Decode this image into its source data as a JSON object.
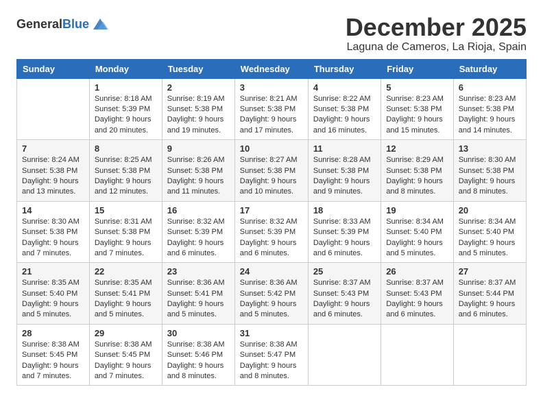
{
  "logo": {
    "general": "General",
    "blue": "Blue"
  },
  "title": "December 2025",
  "location": "Laguna de Cameros, La Rioja, Spain",
  "days_of_week": [
    "Sunday",
    "Monday",
    "Tuesday",
    "Wednesday",
    "Thursday",
    "Friday",
    "Saturday"
  ],
  "weeks": [
    [
      {
        "day": "",
        "sunrise": "",
        "sunset": "",
        "daylight": ""
      },
      {
        "day": "1",
        "sunrise": "Sunrise: 8:18 AM",
        "sunset": "Sunset: 5:39 PM",
        "daylight": "Daylight: 9 hours and 20 minutes."
      },
      {
        "day": "2",
        "sunrise": "Sunrise: 8:19 AM",
        "sunset": "Sunset: 5:38 PM",
        "daylight": "Daylight: 9 hours and 19 minutes."
      },
      {
        "day": "3",
        "sunrise": "Sunrise: 8:21 AM",
        "sunset": "Sunset: 5:38 PM",
        "daylight": "Daylight: 9 hours and 17 minutes."
      },
      {
        "day": "4",
        "sunrise": "Sunrise: 8:22 AM",
        "sunset": "Sunset: 5:38 PM",
        "daylight": "Daylight: 9 hours and 16 minutes."
      },
      {
        "day": "5",
        "sunrise": "Sunrise: 8:23 AM",
        "sunset": "Sunset: 5:38 PM",
        "daylight": "Daylight: 9 hours and 15 minutes."
      },
      {
        "day": "6",
        "sunrise": "Sunrise: 8:23 AM",
        "sunset": "Sunset: 5:38 PM",
        "daylight": "Daylight: 9 hours and 14 minutes."
      }
    ],
    [
      {
        "day": "7",
        "sunrise": "Sunrise: 8:24 AM",
        "sunset": "Sunset: 5:38 PM",
        "daylight": "Daylight: 9 hours and 13 minutes."
      },
      {
        "day": "8",
        "sunrise": "Sunrise: 8:25 AM",
        "sunset": "Sunset: 5:38 PM",
        "daylight": "Daylight: 9 hours and 12 minutes."
      },
      {
        "day": "9",
        "sunrise": "Sunrise: 8:26 AM",
        "sunset": "Sunset: 5:38 PM",
        "daylight": "Daylight: 9 hours and 11 minutes."
      },
      {
        "day": "10",
        "sunrise": "Sunrise: 8:27 AM",
        "sunset": "Sunset: 5:38 PM",
        "daylight": "Daylight: 9 hours and 10 minutes."
      },
      {
        "day": "11",
        "sunrise": "Sunrise: 8:28 AM",
        "sunset": "Sunset: 5:38 PM",
        "daylight": "Daylight: 9 hours and 9 minutes."
      },
      {
        "day": "12",
        "sunrise": "Sunrise: 8:29 AM",
        "sunset": "Sunset: 5:38 PM",
        "daylight": "Daylight: 9 hours and 8 minutes."
      },
      {
        "day": "13",
        "sunrise": "Sunrise: 8:30 AM",
        "sunset": "Sunset: 5:38 PM",
        "daylight": "Daylight: 9 hours and 8 minutes."
      }
    ],
    [
      {
        "day": "14",
        "sunrise": "Sunrise: 8:30 AM",
        "sunset": "Sunset: 5:38 PM",
        "daylight": "Daylight: 9 hours and 7 minutes."
      },
      {
        "day": "15",
        "sunrise": "Sunrise: 8:31 AM",
        "sunset": "Sunset: 5:38 PM",
        "daylight": "Daylight: 9 hours and 7 minutes."
      },
      {
        "day": "16",
        "sunrise": "Sunrise: 8:32 AM",
        "sunset": "Sunset: 5:39 PM",
        "daylight": "Daylight: 9 hours and 6 minutes."
      },
      {
        "day": "17",
        "sunrise": "Sunrise: 8:32 AM",
        "sunset": "Sunset: 5:39 PM",
        "daylight": "Daylight: 9 hours and 6 minutes."
      },
      {
        "day": "18",
        "sunrise": "Sunrise: 8:33 AM",
        "sunset": "Sunset: 5:39 PM",
        "daylight": "Daylight: 9 hours and 6 minutes."
      },
      {
        "day": "19",
        "sunrise": "Sunrise: 8:34 AM",
        "sunset": "Sunset: 5:40 PM",
        "daylight": "Daylight: 9 hours and 5 minutes."
      },
      {
        "day": "20",
        "sunrise": "Sunrise: 8:34 AM",
        "sunset": "Sunset: 5:40 PM",
        "daylight": "Daylight: 9 hours and 5 minutes."
      }
    ],
    [
      {
        "day": "21",
        "sunrise": "Sunrise: 8:35 AM",
        "sunset": "Sunset: 5:40 PM",
        "daylight": "Daylight: 9 hours and 5 minutes."
      },
      {
        "day": "22",
        "sunrise": "Sunrise: 8:35 AM",
        "sunset": "Sunset: 5:41 PM",
        "daylight": "Daylight: 9 hours and 5 minutes."
      },
      {
        "day": "23",
        "sunrise": "Sunrise: 8:36 AM",
        "sunset": "Sunset: 5:41 PM",
        "daylight": "Daylight: 9 hours and 5 minutes."
      },
      {
        "day": "24",
        "sunrise": "Sunrise: 8:36 AM",
        "sunset": "Sunset: 5:42 PM",
        "daylight": "Daylight: 9 hours and 5 minutes."
      },
      {
        "day": "25",
        "sunrise": "Sunrise: 8:37 AM",
        "sunset": "Sunset: 5:43 PM",
        "daylight": "Daylight: 9 hours and 6 minutes."
      },
      {
        "day": "26",
        "sunrise": "Sunrise: 8:37 AM",
        "sunset": "Sunset: 5:43 PM",
        "daylight": "Daylight: 9 hours and 6 minutes."
      },
      {
        "day": "27",
        "sunrise": "Sunrise: 8:37 AM",
        "sunset": "Sunset: 5:44 PM",
        "daylight": "Daylight: 9 hours and 6 minutes."
      }
    ],
    [
      {
        "day": "28",
        "sunrise": "Sunrise: 8:38 AM",
        "sunset": "Sunset: 5:45 PM",
        "daylight": "Daylight: 9 hours and 7 minutes."
      },
      {
        "day": "29",
        "sunrise": "Sunrise: 8:38 AM",
        "sunset": "Sunset: 5:45 PM",
        "daylight": "Daylight: 9 hours and 7 minutes."
      },
      {
        "day": "30",
        "sunrise": "Sunrise: 8:38 AM",
        "sunset": "Sunset: 5:46 PM",
        "daylight": "Daylight: 9 hours and 8 minutes."
      },
      {
        "day": "31",
        "sunrise": "Sunrise: 8:38 AM",
        "sunset": "Sunset: 5:47 PM",
        "daylight": "Daylight: 9 hours and 8 minutes."
      },
      {
        "day": "",
        "sunrise": "",
        "sunset": "",
        "daylight": ""
      },
      {
        "day": "",
        "sunrise": "",
        "sunset": "",
        "daylight": ""
      },
      {
        "day": "",
        "sunrise": "",
        "sunset": "",
        "daylight": ""
      }
    ]
  ]
}
